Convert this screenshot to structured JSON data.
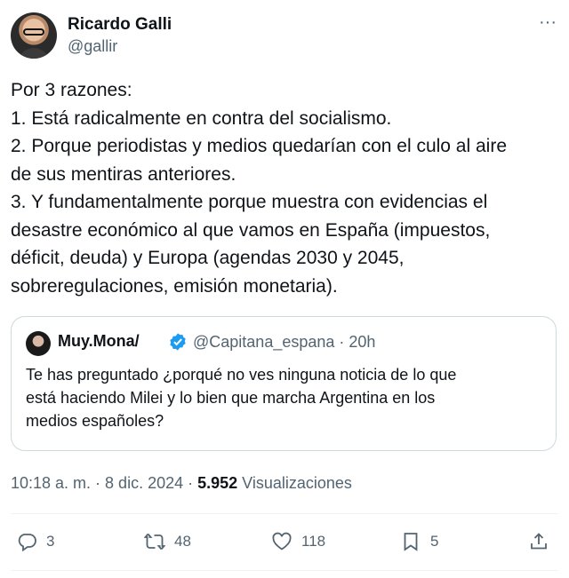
{
  "author": {
    "name": "Ricardo Galli",
    "handle": "@gallir"
  },
  "more_label": "···",
  "tweet_lines": [
    "Por 3 razones:",
    "1. Está radicalmente en contra del socialismo.",
    "2. Porque periodistas y medios quedarían con el culo al aire",
    "de sus mentiras anteriores.",
    "3. Y fundamentalmente porque muestra con evidencias el",
    "desastre económico al que vamos en España (impuestos,",
    "déficit, deuda) y Europa (agendas 2030 y 2045,",
    "sobreregulaciones, emisión monetaria)."
  ],
  "quote": {
    "name": "Muy.Mona/",
    "verified": true,
    "handle_time": "@Capitana_espana · 20h",
    "text_lines": [
      "Te has preguntado ¿porqué no ves ninguna noticia de lo que",
      "está haciendo Milei y lo bien que marcha Argentina en los",
      "medios españoles?"
    ]
  },
  "meta": {
    "datetime": "10:18 a. m. · 8 dic. 2024 · ",
    "views_count": "5.952",
    "views_label": " Visualizaciones"
  },
  "actions": {
    "replies": "3",
    "reposts": "48",
    "likes": "118",
    "bookmarks": "5"
  },
  "colors": {
    "text": "#0f1419",
    "secondary": "#536471",
    "border": "#cfd9de",
    "verified": "#1d9bf0"
  },
  "icons": [
    "reply-icon",
    "repost-icon",
    "heart-icon",
    "bookmark-icon",
    "share-icon",
    "more-icon",
    "verified-badge-icon"
  ]
}
